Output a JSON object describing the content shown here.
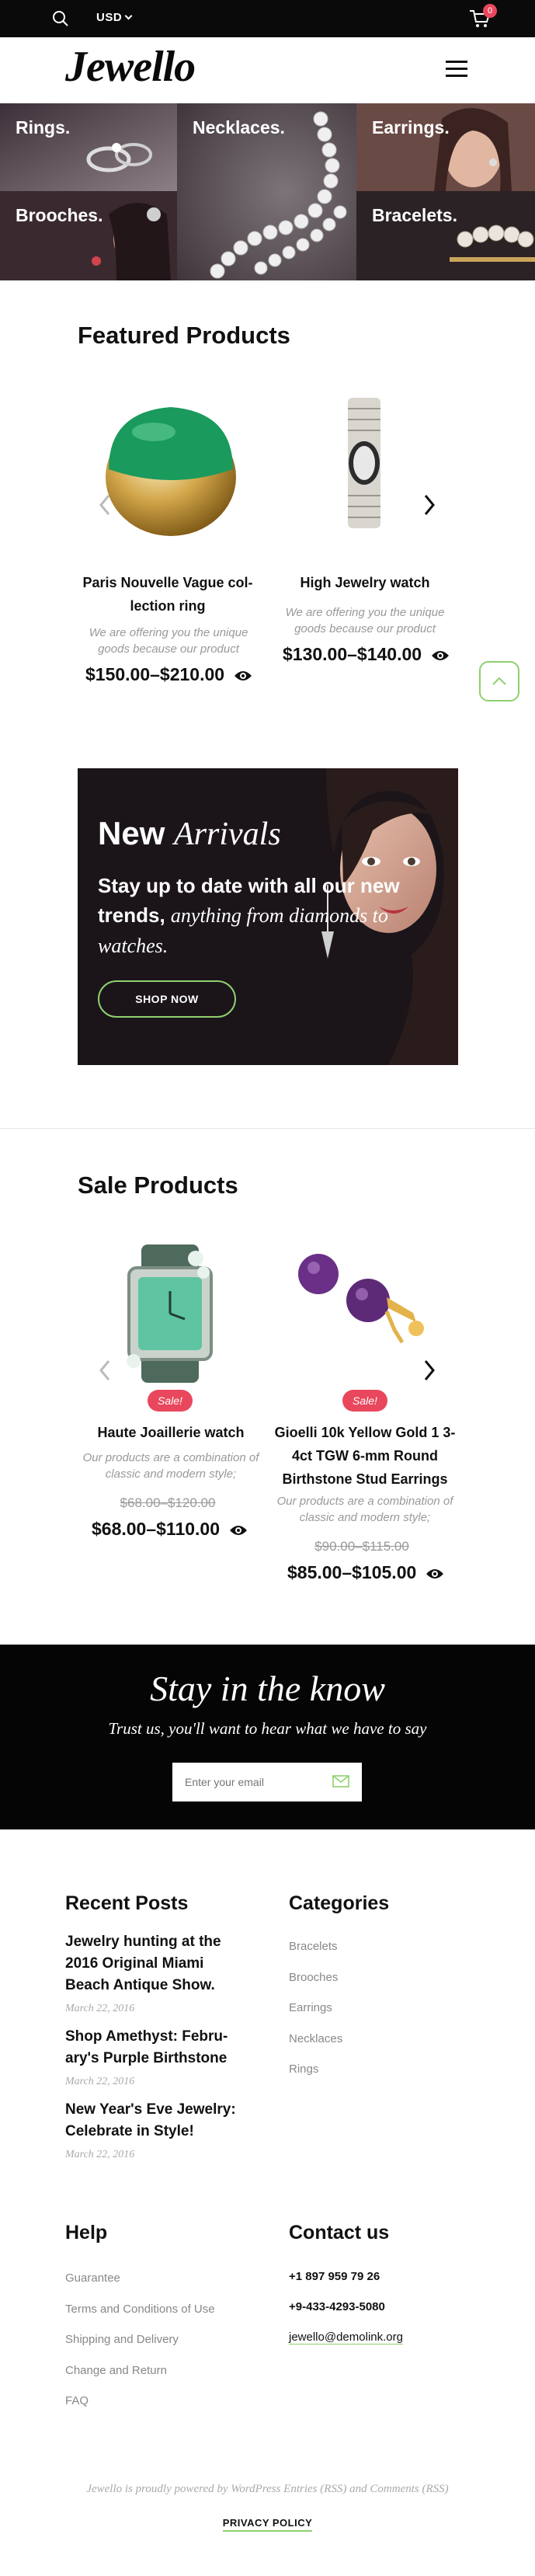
{
  "topbar": {
    "currency": "USD",
    "cart_count": "0"
  },
  "header": {
    "logo": "Jewello"
  },
  "categories": [
    {
      "label": "Rings."
    },
    {
      "label": "Necklaces."
    },
    {
      "label": "Earrings."
    },
    {
      "label": "Brooches."
    },
    {
      "label": "Bracelets."
    }
  ],
  "featured": {
    "title": "Featured Products",
    "products": [
      {
        "name": "Paris Nouvelle Vague col-lection ring",
        "desc": "We are offering you the unique goods because our product",
        "price": "$150.00–$210.00"
      },
      {
        "name": "High Jewelry watch",
        "desc": "We are offering you the unique goods because our product",
        "price": "$130.00–$140.00"
      }
    ]
  },
  "promo": {
    "title_bold": "New",
    "title_italic": "Arrivals",
    "line_bold": "Stay up to date with all our new trends,",
    "line_italic": "anything from diamonds to watches.",
    "button": "SHOP NOW"
  },
  "sale": {
    "title": "Sale Products",
    "badge": "Sale!",
    "products": [
      {
        "name": "Haute Joaillerie watch",
        "desc": "Our products are a combination of classic and modern style;",
        "old_price": "$68.00–$120.00",
        "price": "$68.00–$110.00"
      },
      {
        "name": "Gioelli 10k Yellow Gold 1 3-4ct TGW 6-mm Round Birthstone Stud Earrings",
        "desc": "Our products are a combination of classic and modern style;",
        "old_price": "$90.00–$115.00",
        "price": "$85.00–$105.00"
      }
    ]
  },
  "newsletter": {
    "title": "Stay in the know",
    "subtitle": "Trust us, you'll want to hear what we have to say",
    "placeholder": "Enter your email"
  },
  "footer": {
    "recent_title": "Recent Posts",
    "posts": [
      {
        "title": "Jewelry hunting at the 2016 Original Miami Beach Antique Show.",
        "date": "March 22, 2016"
      },
      {
        "title": "Shop Amethyst: Febru-ary's Purple Birthstone",
        "date": "March 22, 2016"
      },
      {
        "title": "New Year's Eve Jewelry: Celebrate in Style!",
        "date": "March 22, 2016"
      }
    ],
    "categories_title": "Categories",
    "categories": [
      "Bracelets",
      "Brooches",
      "Earrings",
      "Necklaces",
      "Rings"
    ],
    "help_title": "Help",
    "help_links": [
      "Guarantee",
      "Terms and Conditions of Use",
      "Shipping and Delivery",
      "Change and Return",
      "FAQ"
    ],
    "contact_title": "Contact us",
    "phone1": "+1 897 959 79 26",
    "phone2": "+9-433-4293-5080",
    "email": "jewello@demolink.org",
    "powered": "Jewello is proudly powered by WordPress Entries (RSS) and Comments (RSS)",
    "privacy": "PRIVACY POLICY"
  },
  "colors": {
    "accent": "#8ed06d",
    "sale": "#e9475d",
    "dark": "#0a0a0a"
  },
  "icons": [
    "search-icon",
    "cart-icon",
    "menu-icon",
    "eye-icon",
    "chevron-left-icon",
    "chevron-right-icon",
    "chevron-up-icon",
    "mail-icon"
  ]
}
